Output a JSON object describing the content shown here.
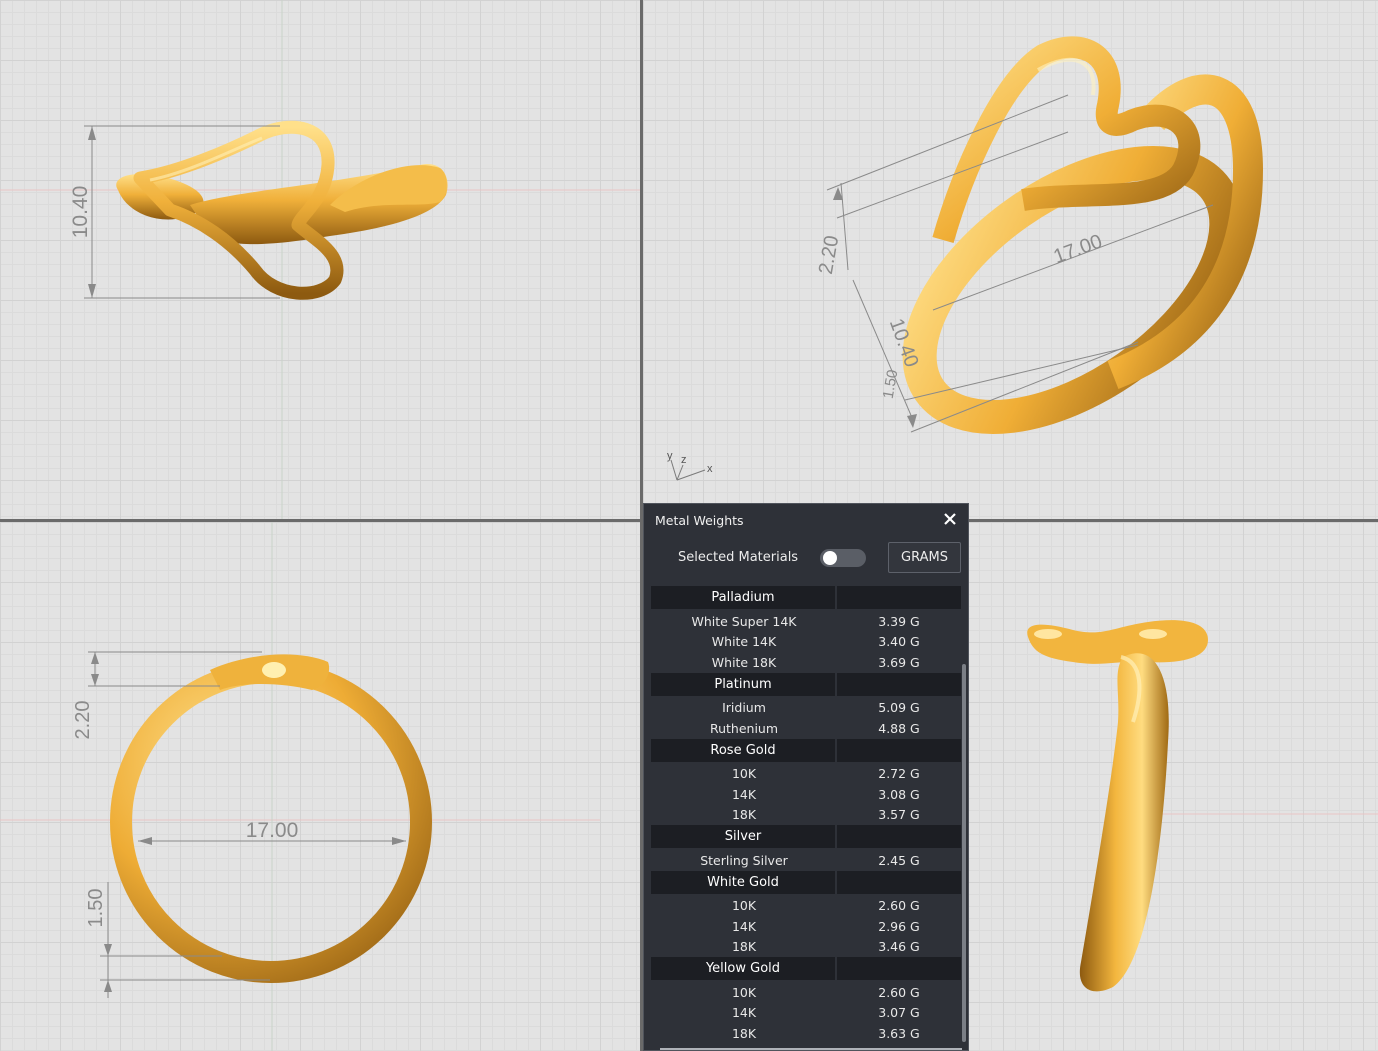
{
  "views": {
    "front": {
      "height_dim": "10.40"
    },
    "perspective": {
      "dim_top": "2.20",
      "dim_width": "17.00",
      "dim_height": "10.40",
      "dim_bottom": "1.50",
      "axis_labels": {
        "y": "y",
        "z": "z",
        "x": "x"
      }
    },
    "top": {
      "dim_top": "2.20",
      "dim_inner": "17.00",
      "dim_bottom": "1.50"
    }
  },
  "colors": {
    "gold_light": "#ffdc7a",
    "gold_mid": "#f2b33a",
    "gold_dark": "#9a6210",
    "panel_bg": "#2e3138",
    "header_bg": "#1c1e23"
  },
  "panel": {
    "title": "Metal Weights",
    "close_icon": "close-icon",
    "selected_materials_label": "Selected Materials",
    "selected_materials_on": false,
    "units_button": "GRAMS",
    "groups": [
      {
        "name": "Palladium",
        "items": [
          {
            "name": "White Super 14K",
            "weight": "3.39 G"
          },
          {
            "name": "White 14K",
            "weight": "3.40 G"
          },
          {
            "name": "White 18K",
            "weight": "3.69 G"
          }
        ]
      },
      {
        "name": "Platinum",
        "items": [
          {
            "name": "Iridium",
            "weight": "5.09 G"
          },
          {
            "name": "Ruthenium",
            "weight": "4.88 G"
          }
        ]
      },
      {
        "name": "Rose Gold",
        "items": [
          {
            "name": "10K",
            "weight": "2.72 G"
          },
          {
            "name": "14K",
            "weight": "3.08 G"
          },
          {
            "name": "18K",
            "weight": "3.57 G"
          }
        ]
      },
      {
        "name": "Silver",
        "items": [
          {
            "name": "Sterling Silver",
            "weight": "2.45 G"
          }
        ]
      },
      {
        "name": "White Gold",
        "items": [
          {
            "name": "10K",
            "weight": "2.60 G"
          },
          {
            "name": "14K",
            "weight": "2.96 G"
          },
          {
            "name": "18K",
            "weight": "3.46 G"
          }
        ]
      },
      {
        "name": "Yellow Gold",
        "items": [
          {
            "name": "10K",
            "weight": "2.60 G"
          },
          {
            "name": "14K",
            "weight": "3.07 G"
          },
          {
            "name": "18K",
            "weight": "3.63 G"
          }
        ]
      }
    ]
  }
}
